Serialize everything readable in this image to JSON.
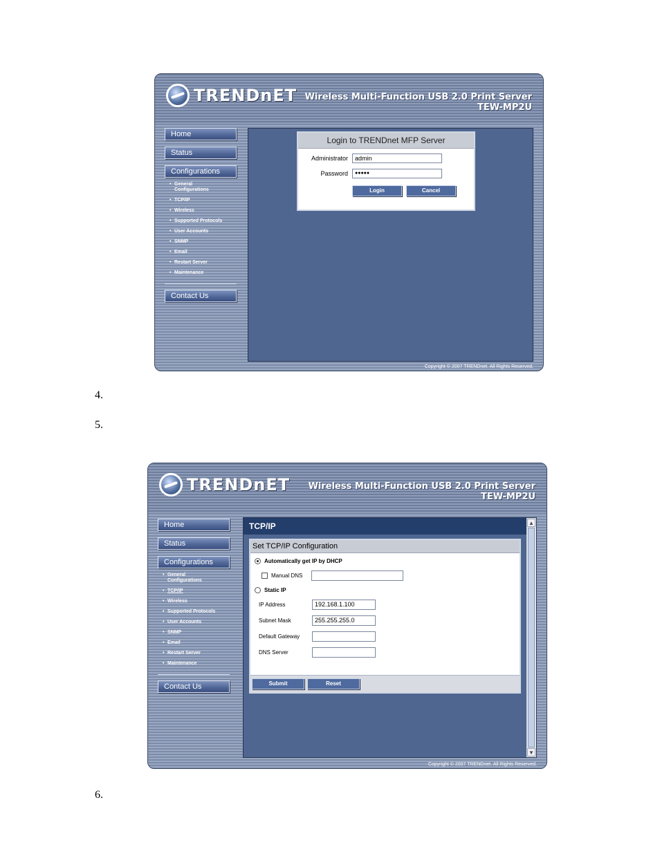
{
  "steps": [
    "4.",
    "5.",
    "6."
  ],
  "brand": {
    "logo_text": "TRENDnET"
  },
  "product": {
    "line1": "Wireless Multi-Function USB 2.0 Print Server",
    "line2": "TEW-MP2U"
  },
  "nav": {
    "home": "Home",
    "status": "Status",
    "configurations": "Configurations",
    "sub": [
      "General Configurations",
      "TCP/IP",
      "Wireless",
      "Supported Protocols",
      "User Accounts",
      "SNMP",
      "Email",
      "Restart Server",
      "Maintenance"
    ],
    "contact": "Contact Us"
  },
  "copyright": "Copyright © 2007 TRENDnet. All Rights Reserved.",
  "login": {
    "title": "Login to TRENDnet MFP Server",
    "admin_label": "Administrator",
    "admin_value": "admin",
    "password_label": "Password",
    "password_value": "●●●●●",
    "login_btn": "Login",
    "cancel_btn": "Cancel"
  },
  "tcpip": {
    "page_title": "TCP/IP",
    "box_title": "Set TCP/IP Configuration",
    "dhcp_label": "Automatically get IP by DHCP",
    "dhcp_selected": true,
    "manual_dns_label": "Manual DNS",
    "manual_dns_value": "",
    "static_label": "Static IP",
    "ip_label": "IP Address",
    "ip_value": "192.168.1.100",
    "mask_label": "Subnet Mask",
    "mask_value": "255.255.255.0",
    "gateway_label": "Default Gateway",
    "gateway_value": "",
    "dns_label": "DNS Server",
    "dns_value": "",
    "submit_btn": "Submit",
    "reset_btn": "Reset",
    "scroll_up": "▲",
    "scroll_down": "▼"
  }
}
